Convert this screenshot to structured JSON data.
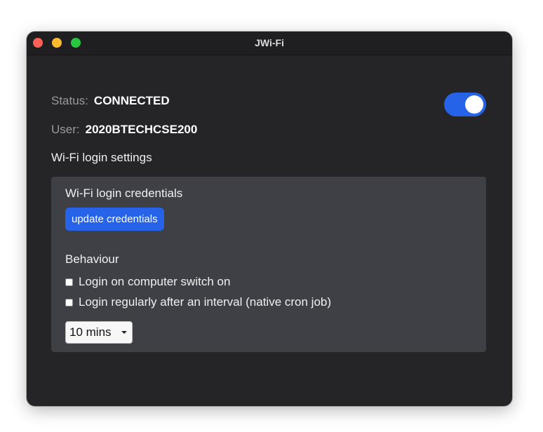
{
  "window": {
    "title": "JWi-Fi"
  },
  "status": {
    "label": "Status:",
    "value": "CONNECTED",
    "toggle_on": true
  },
  "user": {
    "label": "User:",
    "value": "2020BTECHCSE200"
  },
  "settings": {
    "heading": "Wi-Fi login settings",
    "credentials_title": "Wi-Fi login credentials",
    "update_button": "update credentials",
    "behaviour_title": "Behaviour",
    "options": [
      {
        "label": "Login on computer switch on",
        "checked": false
      },
      {
        "label": "Login regularly after an interval (native cron job)",
        "checked": false
      }
    ],
    "interval_selected": "10 mins"
  },
  "colors": {
    "accent": "#2763e8",
    "window_bg": "#252527",
    "panel_bg": "#3f4046"
  }
}
